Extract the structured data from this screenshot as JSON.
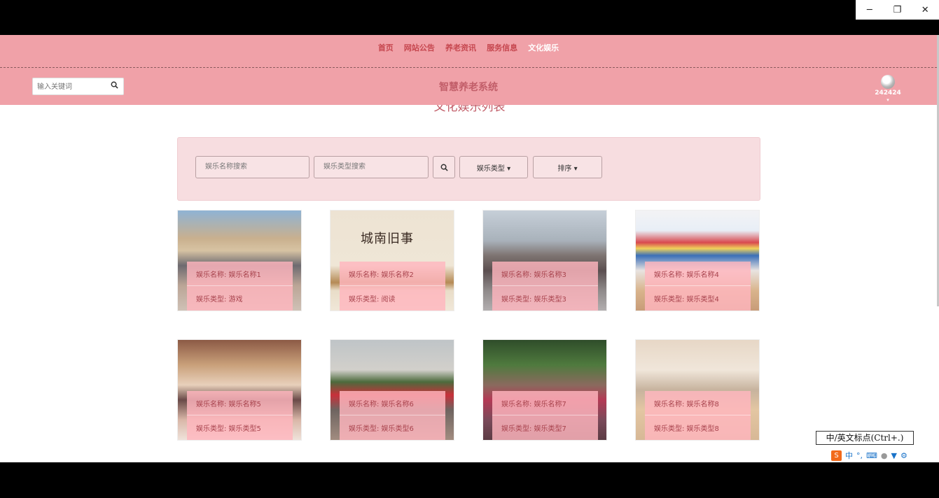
{
  "window": {
    "minimize_icon": "─",
    "restore_icon": "❐",
    "close_icon": "✕"
  },
  "nav": {
    "items": [
      "首页",
      "网站公告",
      "养老资讯",
      "服务信息",
      "文化娱乐"
    ],
    "active_index": 4
  },
  "header": {
    "search_placeholder": "输入关键词",
    "site_title": "智慧养老系统",
    "username": "242424",
    "caret": "▾"
  },
  "page": {
    "list_title": "文化娱乐列表"
  },
  "filter": {
    "name_placeholder": "娱乐名称搜索",
    "type_placeholder": "娱乐类型搜索",
    "type_dropdown": "娱乐类型 ▾",
    "sort_dropdown": "排序 ▾"
  },
  "cards": [
    {
      "name": "娱乐名称: 娱乐名称1",
      "type": "娱乐类型: 游戏"
    },
    {
      "name": "娱乐名称: 娱乐名称2",
      "type": "娱乐类型: 阅读"
    },
    {
      "name": "娱乐名称: 娱乐名称3",
      "type": "娱乐类型: 娱乐类型3"
    },
    {
      "name": "娱乐名称: 娱乐名称4",
      "type": "娱乐类型: 娱乐类型4"
    },
    {
      "name": "娱乐名称: 娱乐名称5",
      "type": "娱乐类型: 娱乐类型5"
    },
    {
      "name": "娱乐名称: 娱乐名称6",
      "type": "娱乐类型: 娱乐类型6"
    },
    {
      "name": "娱乐名称: 娱乐名称7",
      "type": "娱乐类型: 娱乐类型7"
    },
    {
      "name": "娱乐名称: 娱乐名称8",
      "type": "娱乐类型: 娱乐类型8"
    }
  ],
  "book_cover_text": "城南旧事",
  "ime": {
    "tooltip": "中/英文标点(Ctrl+.)",
    "lang": "中",
    "icons": [
      "punctuation-icon",
      "keyboard-icon",
      "user-icon",
      "skin-icon",
      "settings-icon"
    ]
  },
  "colors": {
    "header_bg": "#f0a1a8",
    "accent": "#c25e69",
    "filter_bg": "#f7dde0",
    "overlay": "#ffb6be"
  }
}
